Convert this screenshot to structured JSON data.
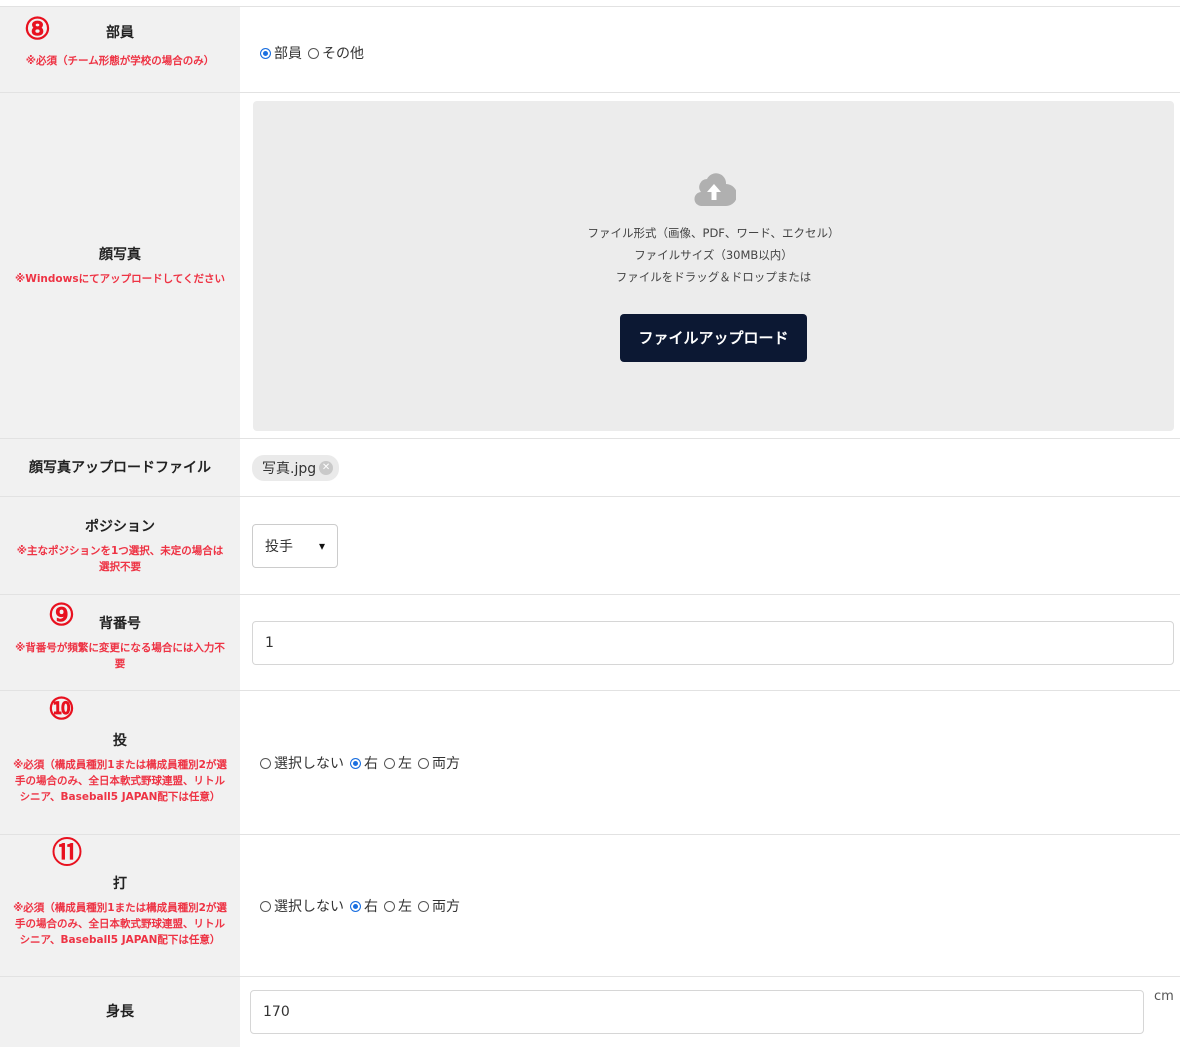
{
  "markers": [
    "⑧",
    "⑨",
    "⑩",
    "⑪"
  ],
  "rows": {
    "member": {
      "label": "部員",
      "note": "※必須（チーム形態が学校の場合のみ）",
      "options": [
        {
          "label": "部員",
          "checked": true
        },
        {
          "label": "その他",
          "checked": false
        }
      ]
    },
    "photo": {
      "label": "顔写真",
      "note": "※Windowsにてアップロードしてください",
      "upload_lines": [
        "ファイル形式（画像、PDF、ワード、エクセル）",
        "ファイルサイズ（30MB以内）",
        "ファイルをドラッグ＆ドロップまたは"
      ],
      "upload_button": "ファイルアップロード"
    },
    "photo_file": {
      "label": "顔写真アップロードファイル",
      "file_name": "写真.jpg"
    },
    "position": {
      "label": "ポジション",
      "note": "※主なポジションを1つ選択、未定の場合は選択不要",
      "selected": "投手"
    },
    "number": {
      "label": "背番号",
      "note": "※背番号が頻繁に変更になる場合には入力不要",
      "value": "1"
    },
    "throw": {
      "label": "投",
      "note": "※必須（構成員種別1または構成員種別2が選手の場合のみ、全日本軟式野球連盟、リトルシニア、Baseball5 JAPAN配下は任意）",
      "options": [
        {
          "label": "選択しない",
          "checked": false
        },
        {
          "label": "右",
          "checked": true
        },
        {
          "label": "左",
          "checked": false
        },
        {
          "label": "両方",
          "checked": false
        }
      ]
    },
    "bat": {
      "label": "打",
      "note": "※必須（構成員種別1または構成員種別2が選手の場合のみ、全日本軟式野球連盟、リトルシニア、Baseball5 JAPAN配下は任意）",
      "options": [
        {
          "label": "選択しない",
          "checked": false
        },
        {
          "label": "右",
          "checked": true
        },
        {
          "label": "左",
          "checked": false
        },
        {
          "label": "両方",
          "checked": false
        }
      ]
    },
    "height": {
      "label": "身長",
      "value": "170",
      "unit": "cm"
    }
  }
}
